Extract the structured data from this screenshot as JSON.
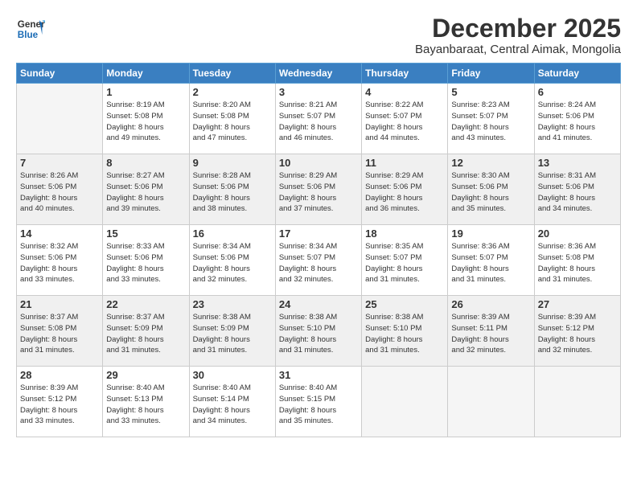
{
  "header": {
    "logo_line1": "General",
    "logo_line2": "Blue",
    "month": "December 2025",
    "location": "Bayanbaraat, Central Aimak, Mongolia"
  },
  "weekdays": [
    "Sunday",
    "Monday",
    "Tuesday",
    "Wednesday",
    "Thursday",
    "Friday",
    "Saturday"
  ],
  "weeks": [
    [
      {
        "num": "",
        "info": ""
      },
      {
        "num": "1",
        "info": "Sunrise: 8:19 AM\nSunset: 5:08 PM\nDaylight: 8 hours\nand 49 minutes."
      },
      {
        "num": "2",
        "info": "Sunrise: 8:20 AM\nSunset: 5:08 PM\nDaylight: 8 hours\nand 47 minutes."
      },
      {
        "num": "3",
        "info": "Sunrise: 8:21 AM\nSunset: 5:07 PM\nDaylight: 8 hours\nand 46 minutes."
      },
      {
        "num": "4",
        "info": "Sunrise: 8:22 AM\nSunset: 5:07 PM\nDaylight: 8 hours\nand 44 minutes."
      },
      {
        "num": "5",
        "info": "Sunrise: 8:23 AM\nSunset: 5:07 PM\nDaylight: 8 hours\nand 43 minutes."
      },
      {
        "num": "6",
        "info": "Sunrise: 8:24 AM\nSunset: 5:06 PM\nDaylight: 8 hours\nand 41 minutes."
      }
    ],
    [
      {
        "num": "7",
        "info": "Sunrise: 8:26 AM\nSunset: 5:06 PM\nDaylight: 8 hours\nand 40 minutes."
      },
      {
        "num": "8",
        "info": "Sunrise: 8:27 AM\nSunset: 5:06 PM\nDaylight: 8 hours\nand 39 minutes."
      },
      {
        "num": "9",
        "info": "Sunrise: 8:28 AM\nSunset: 5:06 PM\nDaylight: 8 hours\nand 38 minutes."
      },
      {
        "num": "10",
        "info": "Sunrise: 8:29 AM\nSunset: 5:06 PM\nDaylight: 8 hours\nand 37 minutes."
      },
      {
        "num": "11",
        "info": "Sunrise: 8:29 AM\nSunset: 5:06 PM\nDaylight: 8 hours\nand 36 minutes."
      },
      {
        "num": "12",
        "info": "Sunrise: 8:30 AM\nSunset: 5:06 PM\nDaylight: 8 hours\nand 35 minutes."
      },
      {
        "num": "13",
        "info": "Sunrise: 8:31 AM\nSunset: 5:06 PM\nDaylight: 8 hours\nand 34 minutes."
      }
    ],
    [
      {
        "num": "14",
        "info": "Sunrise: 8:32 AM\nSunset: 5:06 PM\nDaylight: 8 hours\nand 33 minutes."
      },
      {
        "num": "15",
        "info": "Sunrise: 8:33 AM\nSunset: 5:06 PM\nDaylight: 8 hours\nand 33 minutes."
      },
      {
        "num": "16",
        "info": "Sunrise: 8:34 AM\nSunset: 5:06 PM\nDaylight: 8 hours\nand 32 minutes."
      },
      {
        "num": "17",
        "info": "Sunrise: 8:34 AM\nSunset: 5:07 PM\nDaylight: 8 hours\nand 32 minutes."
      },
      {
        "num": "18",
        "info": "Sunrise: 8:35 AM\nSunset: 5:07 PM\nDaylight: 8 hours\nand 31 minutes."
      },
      {
        "num": "19",
        "info": "Sunrise: 8:36 AM\nSunset: 5:07 PM\nDaylight: 8 hours\nand 31 minutes."
      },
      {
        "num": "20",
        "info": "Sunrise: 8:36 AM\nSunset: 5:08 PM\nDaylight: 8 hours\nand 31 minutes."
      }
    ],
    [
      {
        "num": "21",
        "info": "Sunrise: 8:37 AM\nSunset: 5:08 PM\nDaylight: 8 hours\nand 31 minutes."
      },
      {
        "num": "22",
        "info": "Sunrise: 8:37 AM\nSunset: 5:09 PM\nDaylight: 8 hours\nand 31 minutes."
      },
      {
        "num": "23",
        "info": "Sunrise: 8:38 AM\nSunset: 5:09 PM\nDaylight: 8 hours\nand 31 minutes."
      },
      {
        "num": "24",
        "info": "Sunrise: 8:38 AM\nSunset: 5:10 PM\nDaylight: 8 hours\nand 31 minutes."
      },
      {
        "num": "25",
        "info": "Sunrise: 8:38 AM\nSunset: 5:10 PM\nDaylight: 8 hours\nand 31 minutes."
      },
      {
        "num": "26",
        "info": "Sunrise: 8:39 AM\nSunset: 5:11 PM\nDaylight: 8 hours\nand 32 minutes."
      },
      {
        "num": "27",
        "info": "Sunrise: 8:39 AM\nSunset: 5:12 PM\nDaylight: 8 hours\nand 32 minutes."
      }
    ],
    [
      {
        "num": "28",
        "info": "Sunrise: 8:39 AM\nSunset: 5:12 PM\nDaylight: 8 hours\nand 33 minutes."
      },
      {
        "num": "29",
        "info": "Sunrise: 8:40 AM\nSunset: 5:13 PM\nDaylight: 8 hours\nand 33 minutes."
      },
      {
        "num": "30",
        "info": "Sunrise: 8:40 AM\nSunset: 5:14 PM\nDaylight: 8 hours\nand 34 minutes."
      },
      {
        "num": "31",
        "info": "Sunrise: 8:40 AM\nSunset: 5:15 PM\nDaylight: 8 hours\nand 35 minutes."
      },
      {
        "num": "",
        "info": ""
      },
      {
        "num": "",
        "info": ""
      },
      {
        "num": "",
        "info": ""
      }
    ]
  ]
}
